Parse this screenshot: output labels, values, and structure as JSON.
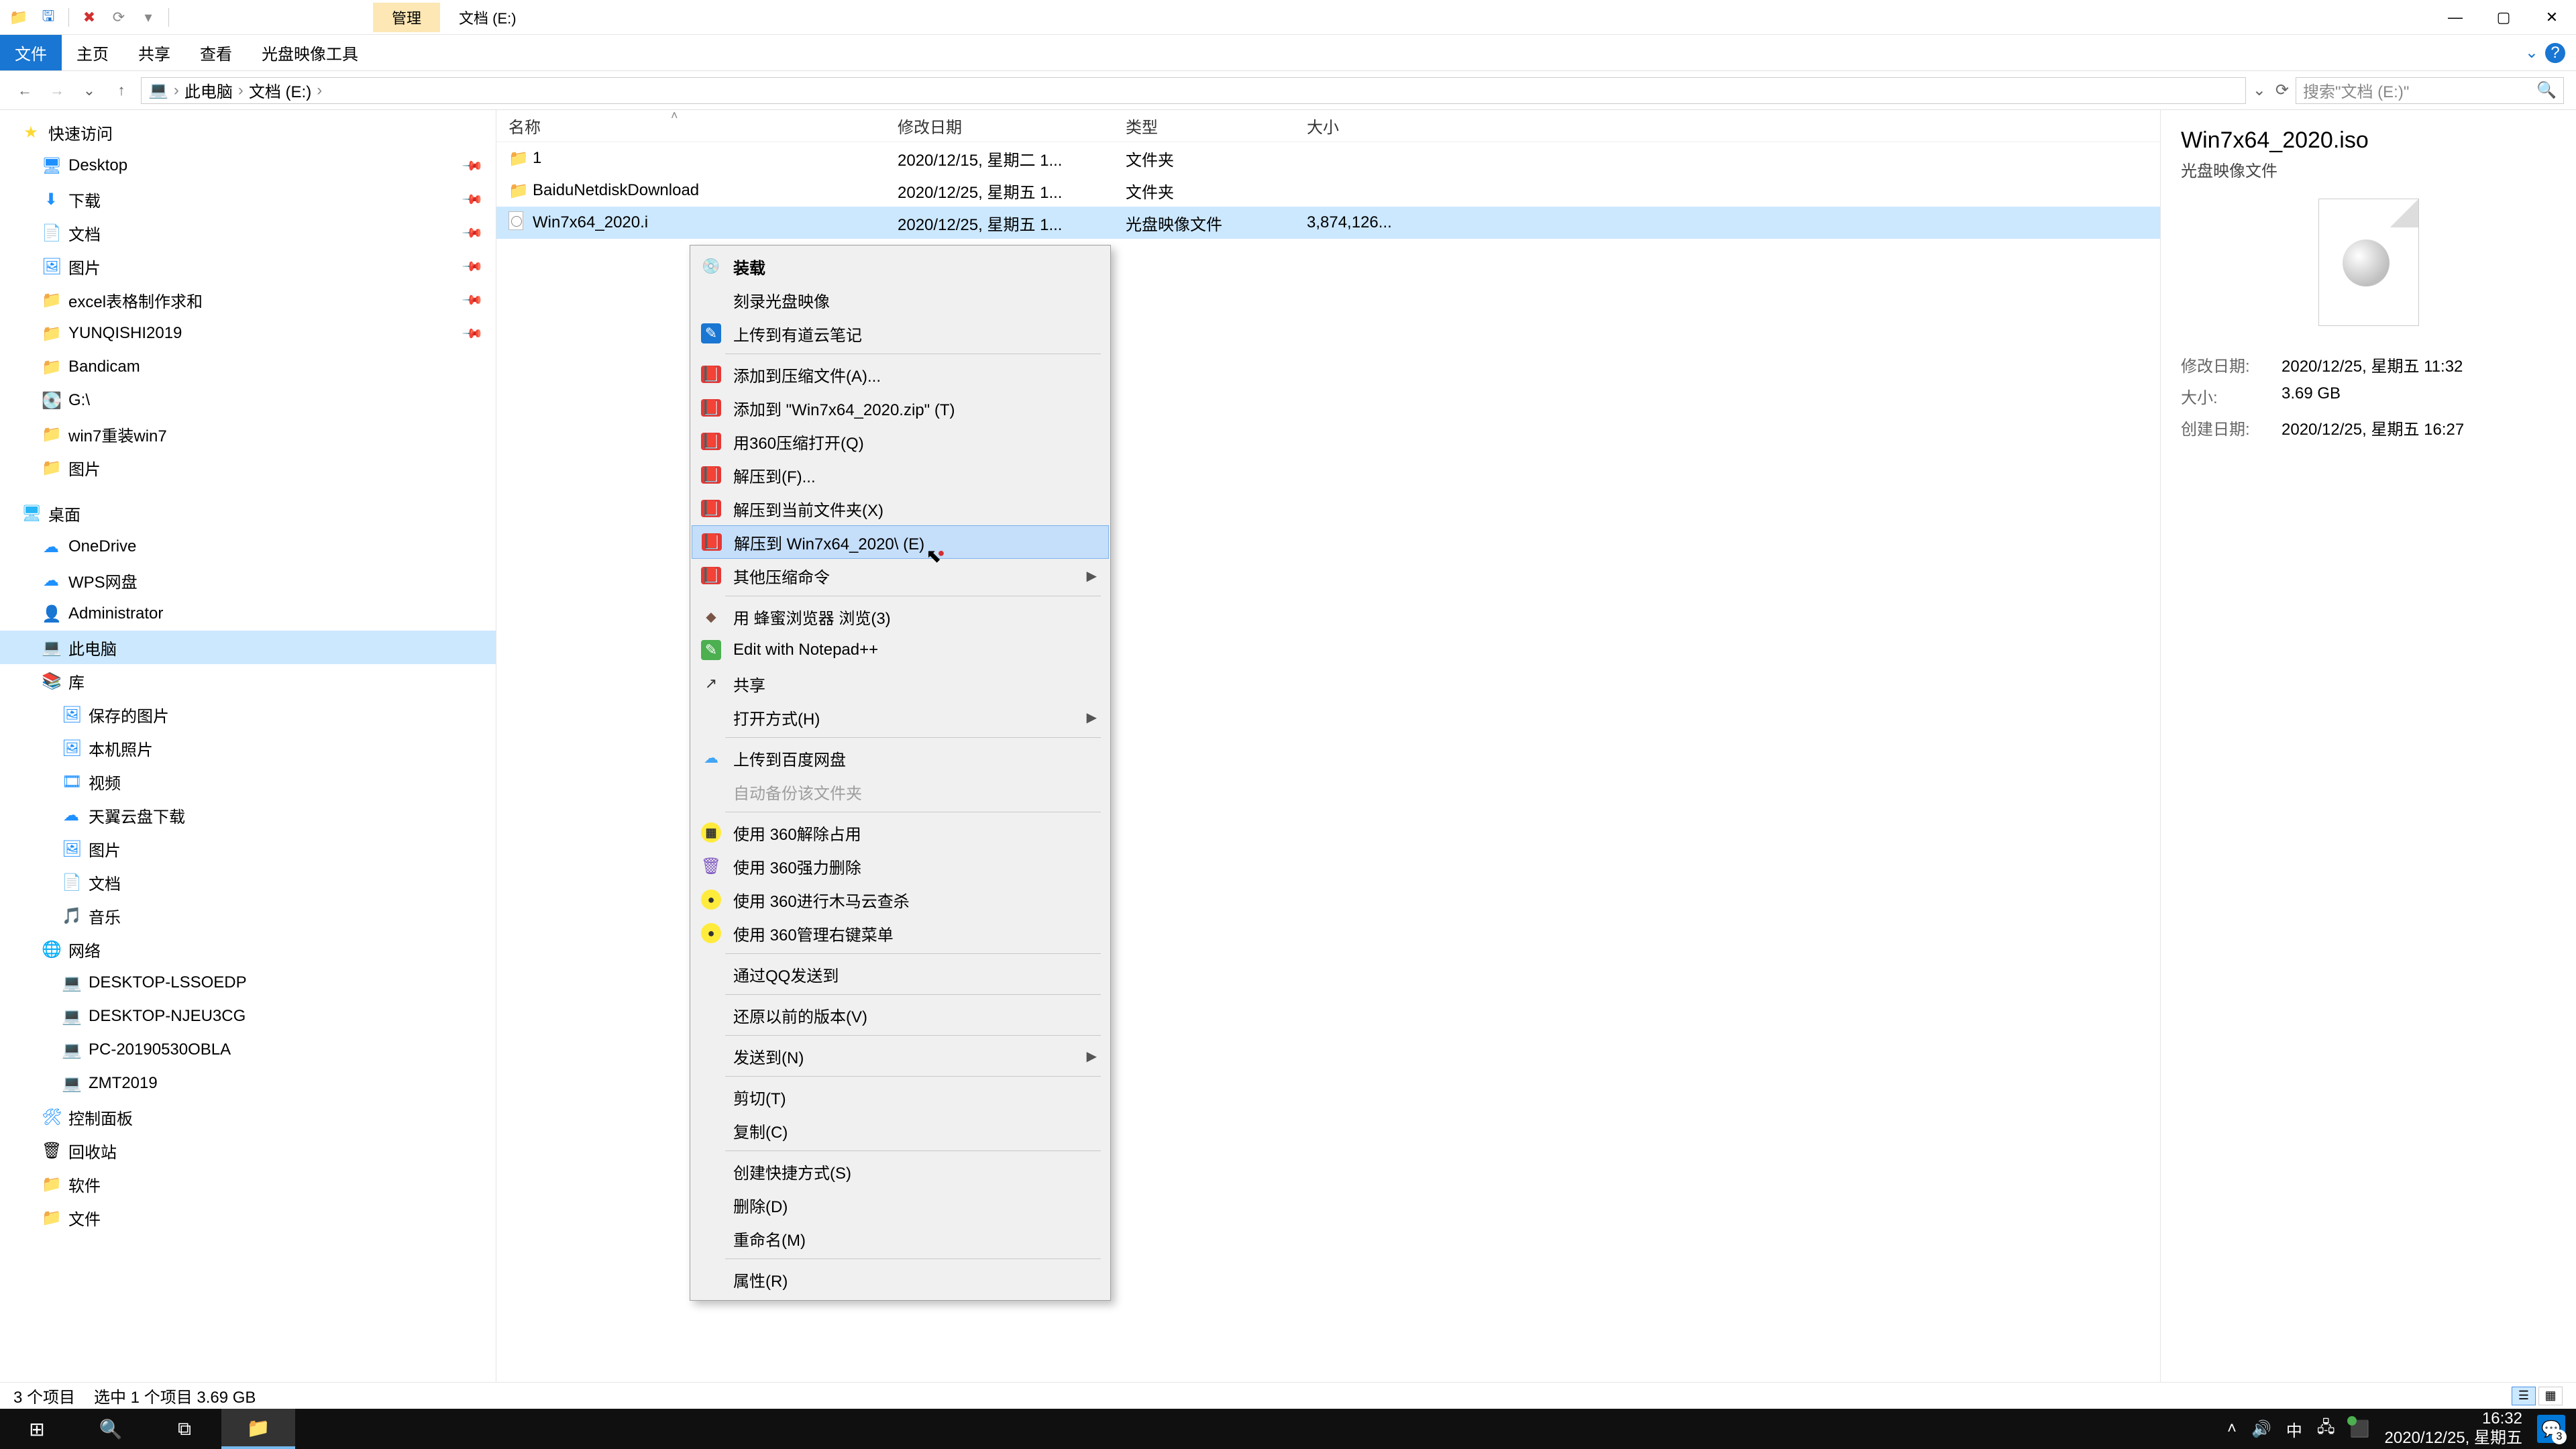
{
  "titlebar": {
    "context_tab": "管理",
    "location_title": "文档 (E:)"
  },
  "window_controls": {
    "min": "—",
    "max": "▢",
    "close": "✕"
  },
  "ribbon": {
    "file": "文件",
    "tabs": [
      "主页",
      "共享",
      "查看",
      "光盘映像工具"
    ],
    "help_chevron": "⌄",
    "help_icon": "?"
  },
  "addrbar": {
    "back": "←",
    "forward": "→",
    "recent": "⌄",
    "up": "↑",
    "crumbs": [
      "此电脑",
      "文档 (E:)"
    ],
    "sep": "›",
    "dropdown": "⌄",
    "refresh": "⟳",
    "search_placeholder": "搜索\"文档 (E:)\"",
    "search_icon": "🔍"
  },
  "navpane": {
    "quick_access": "快速访问",
    "quick_items": [
      {
        "icon": "🖥",
        "label": "Desktop",
        "pinned": true,
        "cls": "nav-blue"
      },
      {
        "icon": "⬇",
        "label": "下载",
        "pinned": true,
        "cls": "nav-blue"
      },
      {
        "icon": "📄",
        "label": "文档",
        "pinned": true,
        "cls": "nav-blue"
      },
      {
        "icon": "🖼",
        "label": "图片",
        "pinned": true,
        "cls": "nav-blue"
      },
      {
        "icon": "📁",
        "label": "excel表格制作求和",
        "pinned": true,
        "cls": "nav-folder"
      },
      {
        "icon": "📁",
        "label": "YUNQISHI2019",
        "pinned": true,
        "cls": "nav-folder"
      },
      {
        "icon": "📁",
        "label": "Bandicam",
        "pinned": false,
        "cls": "nav-folder"
      },
      {
        "icon": "💽",
        "label": "G:\\",
        "pinned": false,
        "cls": ""
      },
      {
        "icon": "📁",
        "label": "win7重装win7",
        "pinned": false,
        "cls": "nav-folder"
      },
      {
        "icon": "📁",
        "label": "图片",
        "pinned": false,
        "cls": "nav-folder"
      }
    ],
    "desktop": "桌面",
    "desktop_items": [
      {
        "icon": "☁",
        "label": "OneDrive",
        "cls": "nav-blue"
      },
      {
        "icon": "☁",
        "label": "WPS网盘",
        "cls": "nav-blue"
      },
      {
        "icon": "👤",
        "label": "Administrator",
        "cls": ""
      },
      {
        "icon": "💻",
        "label": "此电脑",
        "cls": "nav-pc",
        "selected": true
      },
      {
        "icon": "📚",
        "label": "库",
        "cls": "nav-blue"
      }
    ],
    "lib_items": [
      {
        "icon": "🖼",
        "label": "保存的图片",
        "cls": "nav-blue"
      },
      {
        "icon": "🖼",
        "label": "本机照片",
        "cls": "nav-blue"
      },
      {
        "icon": "🎞",
        "label": "视频",
        "cls": "nav-blue"
      },
      {
        "icon": "☁",
        "label": "天翼云盘下载",
        "cls": "nav-blue"
      },
      {
        "icon": "🖼",
        "label": "图片",
        "cls": "nav-blue"
      },
      {
        "icon": "📄",
        "label": "文档",
        "cls": "nav-blue"
      },
      {
        "icon": "🎵",
        "label": "音乐",
        "cls": "nav-blue"
      }
    ],
    "network": "网络",
    "net_items": [
      {
        "icon": "💻",
        "label": "DESKTOP-LSSOEDP"
      },
      {
        "icon": "💻",
        "label": "DESKTOP-NJEU3CG"
      },
      {
        "icon": "💻",
        "label": "PC-20190530OBLA"
      },
      {
        "icon": "💻",
        "label": "ZMT2019"
      }
    ],
    "extras": [
      {
        "icon": "🛠",
        "label": "控制面板",
        "cls": "nav-blue"
      },
      {
        "icon": "🗑",
        "label": "回收站",
        "cls": ""
      },
      {
        "icon": "📁",
        "label": "软件",
        "cls": "nav-folder"
      },
      {
        "icon": "📁",
        "label": "文件",
        "cls": "nav-folder"
      }
    ]
  },
  "columns": {
    "name": "名称",
    "date": "修改日期",
    "type": "类型",
    "size": "大小",
    "sort": "˄"
  },
  "rows": [
    {
      "icon": "folder",
      "name": "1",
      "date": "2020/12/15, 星期二 1...",
      "type": "文件夹",
      "size": ""
    },
    {
      "icon": "folder",
      "name": "BaiduNetdiskDownload",
      "date": "2020/12/25, 星期五 1...",
      "type": "文件夹",
      "size": ""
    },
    {
      "icon": "iso",
      "name": "Win7x64_2020.iso",
      "date": "2020/12/25, 星期五 1...",
      "type": "光盘映像文件",
      "size": "3,874,126...",
      "selected": true,
      "name_cut": "Win7x64_2020.i"
    }
  ],
  "details": {
    "title": "Win7x64_2020.iso",
    "sub": "光盘映像文件",
    "rows": [
      {
        "label": "修改日期:",
        "value": "2020/12/25, 星期五 11:32"
      },
      {
        "label": "大小:",
        "value": "3.69 GB"
      },
      {
        "label": "创建日期:",
        "value": "2020/12/25, 星期五 16:27"
      }
    ]
  },
  "context_menu": [
    {
      "type": "item",
      "label": "装载",
      "icon": "💿",
      "bold": true
    },
    {
      "type": "item",
      "label": "刻录光盘映像"
    },
    {
      "type": "item",
      "label": "上传到有道云笔记",
      "icon": "✎",
      "iconCls": "ic-note"
    },
    {
      "type": "sep"
    },
    {
      "type": "item",
      "label": "添加到压缩文件(A)...",
      "icon": "📕",
      "iconCls": "ic-book"
    },
    {
      "type": "item",
      "label": "添加到 \"Win7x64_2020.zip\" (T)",
      "icon": "📕",
      "iconCls": "ic-book"
    },
    {
      "type": "item",
      "label": "用360压缩打开(Q)",
      "icon": "📕",
      "iconCls": "ic-book"
    },
    {
      "type": "item",
      "label": "解压到(F)...",
      "icon": "📕",
      "iconCls": "ic-book"
    },
    {
      "type": "item",
      "label": "解压到当前文件夹(X)",
      "icon": "📕",
      "iconCls": "ic-book"
    },
    {
      "type": "item",
      "label": "解压到 Win7x64_2020\\ (E)",
      "icon": "📕",
      "iconCls": "ic-book",
      "highlight": true
    },
    {
      "type": "item",
      "label": "其他压缩命令",
      "icon": "📕",
      "iconCls": "ic-book",
      "submenu": true
    },
    {
      "type": "sep"
    },
    {
      "type": "item",
      "label": "用 蜂蜜浏览器 浏览(3)",
      "icon": "◆",
      "iconCls": "ic-bee"
    },
    {
      "type": "item",
      "label": "Edit with Notepad++",
      "icon": "✎",
      "iconCls": "ic-green"
    },
    {
      "type": "item",
      "label": "共享",
      "icon": "↗",
      "iconCls": "ic-share"
    },
    {
      "type": "item",
      "label": "打开方式(H)",
      "submenu": true
    },
    {
      "type": "sep"
    },
    {
      "type": "item",
      "label": "上传到百度网盘",
      "icon": "☁",
      "iconCls": "ic-cloud"
    },
    {
      "type": "item",
      "label": "自动备份该文件夹",
      "disabled": true
    },
    {
      "type": "sep"
    },
    {
      "type": "item",
      "label": "使用 360解除占用",
      "icon": "▦",
      "iconCls": "ic-360"
    },
    {
      "type": "item",
      "label": "使用 360强力删除",
      "icon": "🗑",
      "iconCls": "ic-trash"
    },
    {
      "type": "item",
      "label": "使用 360进行木马云查杀",
      "icon": "●",
      "iconCls": "ic-360"
    },
    {
      "type": "item",
      "label": "使用 360管理右键菜单",
      "icon": "●",
      "iconCls": "ic-360"
    },
    {
      "type": "sep"
    },
    {
      "type": "item",
      "label": "通过QQ发送到"
    },
    {
      "type": "sep"
    },
    {
      "type": "item",
      "label": "还原以前的版本(V)"
    },
    {
      "type": "sep"
    },
    {
      "type": "item",
      "label": "发送到(N)",
      "submenu": true
    },
    {
      "type": "sep"
    },
    {
      "type": "item",
      "label": "剪切(T)"
    },
    {
      "type": "item",
      "label": "复制(C)"
    },
    {
      "type": "sep"
    },
    {
      "type": "item",
      "label": "创建快捷方式(S)"
    },
    {
      "type": "item",
      "label": "删除(D)"
    },
    {
      "type": "item",
      "label": "重命名(M)"
    },
    {
      "type": "sep"
    },
    {
      "type": "item",
      "label": "属性(R)"
    }
  ],
  "statusbar": {
    "count": "3 个项目",
    "selection": "选中 1 个项目  3.69 GB"
  },
  "taskbar": {
    "start": "⊞",
    "search": "🔍",
    "taskview": "⧉",
    "explorer": "📁",
    "tray": {
      "up": "˄",
      "vol": "🔊",
      "ime": "中",
      "net": "🖧",
      "app": "⬛"
    },
    "time": "16:32",
    "date": "2020/12/25, 星期五",
    "badge": "3"
  }
}
